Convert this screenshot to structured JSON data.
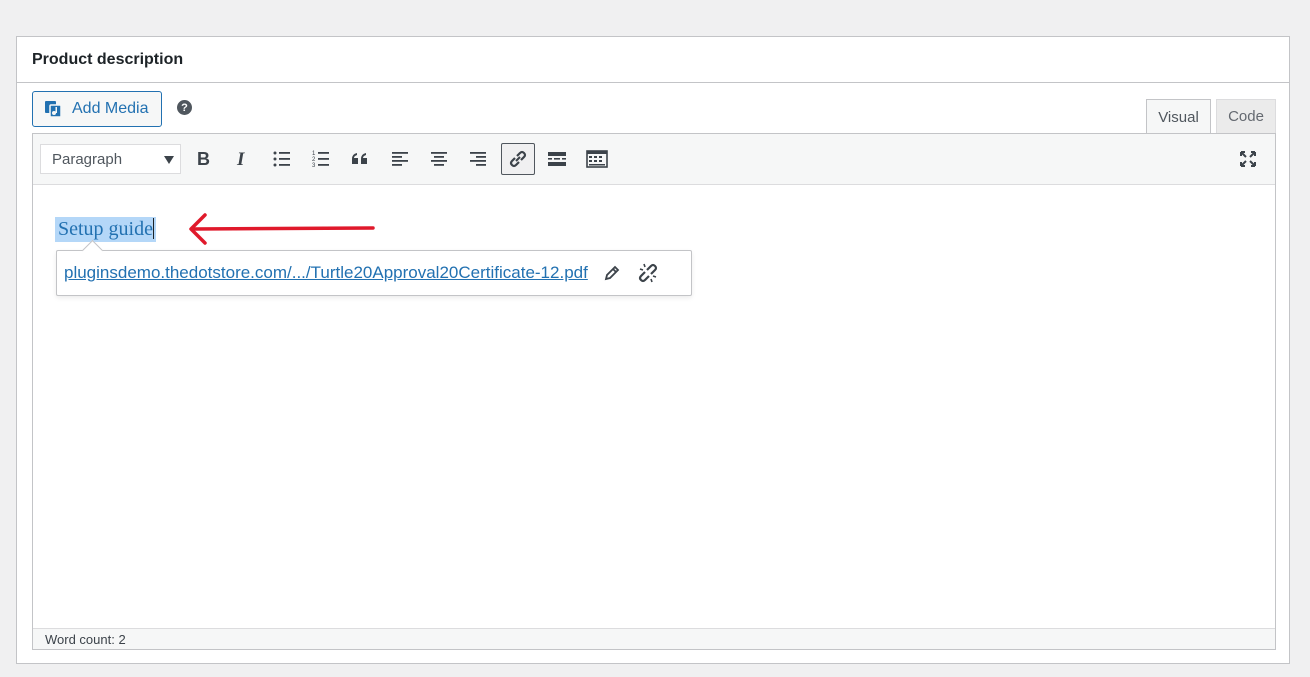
{
  "postbox": {
    "title": "Product description"
  },
  "toolbar_top": {
    "add_media_label": "Add Media",
    "help_label": "?"
  },
  "tabs": [
    {
      "label": "Visual"
    },
    {
      "label": "Code"
    }
  ],
  "format_select": {
    "value": "Paragraph"
  },
  "toolbar_icons": [
    "bold-icon",
    "italic-icon",
    "bullet-list-icon",
    "numbered-list-icon",
    "blockquote-icon",
    "align-left-icon",
    "align-center-icon",
    "align-right-icon",
    "link-icon",
    "read-more-icon",
    "toolbar-toggle-icon",
    "fullscreen-icon"
  ],
  "editor": {
    "selected_text": "Setup guide",
    "link_popup": {
      "url": "pluginsdemo.thedotstore.com/.../Turtle20Approval20Certificate-12.pdf"
    }
  },
  "status": {
    "word_count": "Word count: 2"
  },
  "colors": {
    "accent": "#2271b1",
    "selection": "#b4d7f8",
    "annotation_arrow": "#e0192b"
  }
}
